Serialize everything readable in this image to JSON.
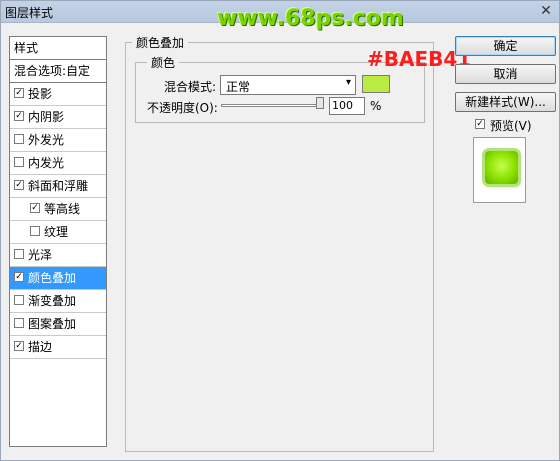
{
  "window": {
    "title": "图层样式",
    "close_glyph": "✕"
  },
  "watermark": "www.68ps.com",
  "styles_panel": {
    "header": "样式",
    "blending_options": "混合选项:自定",
    "items": [
      {
        "label": "投影",
        "checked": true,
        "selected": false,
        "indent": 0
      },
      {
        "label": "内阴影",
        "checked": true,
        "selected": false,
        "indent": 0
      },
      {
        "label": "外发光",
        "checked": false,
        "selected": false,
        "indent": 0
      },
      {
        "label": "内发光",
        "checked": false,
        "selected": false,
        "indent": 0
      },
      {
        "label": "斜面和浮雕",
        "checked": true,
        "selected": false,
        "indent": 0
      },
      {
        "label": "等高线",
        "checked": true,
        "selected": false,
        "indent": 1
      },
      {
        "label": "纹理",
        "checked": false,
        "selected": false,
        "indent": 1
      },
      {
        "label": "光泽",
        "checked": false,
        "selected": false,
        "indent": 0
      },
      {
        "label": "颜色叠加",
        "checked": true,
        "selected": true,
        "indent": 0
      },
      {
        "label": "渐变叠加",
        "checked": false,
        "selected": false,
        "indent": 0
      },
      {
        "label": "图案叠加",
        "checked": false,
        "selected": false,
        "indent": 0
      },
      {
        "label": "描边",
        "checked": true,
        "selected": false,
        "indent": 0
      }
    ]
  },
  "color_overlay": {
    "group_title": "颜色叠加",
    "subgroup_title": "颜色",
    "blend_mode_label": "混合模式:",
    "blend_mode_value": "正常",
    "dropdown_arrow": "▾",
    "swatch_color": "#BAEB41",
    "color_annotation": "#BAEB41",
    "opacity_label": "不透明度(O):",
    "opacity_value": "100",
    "opacity_unit": "%"
  },
  "buttons": {
    "ok": "确定",
    "cancel": "取消",
    "new_style": "新建样式(W)..."
  },
  "preview": {
    "label": "预览(V)",
    "checked": true,
    "check_glyph": "✓"
  }
}
